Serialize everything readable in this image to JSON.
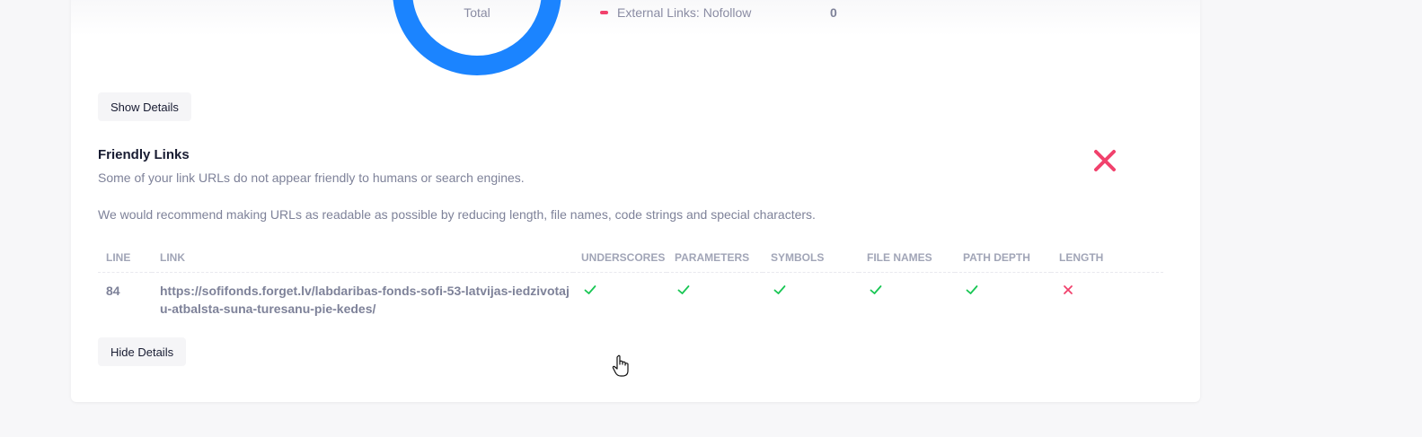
{
  "summary": {
    "donut_center_label": "Total",
    "donut_color": "#1b84ff",
    "legend": {
      "label": "External Links: Nofollow",
      "value": "0",
      "color": "#f1416c"
    }
  },
  "buttons": {
    "show_details": "Show Details",
    "hide_details": "Hide Details"
  },
  "friendly_links": {
    "title": "Friendly Links",
    "status": "fail",
    "status_color": "#f1416c",
    "description": "Some of your link URLs do not appear friendly to humans or search engines.",
    "recommendation": "We would recommend making URLs as readable as possible by reducing length, file names, code strings and special characters.",
    "table": {
      "headers": [
        "LINE",
        "LINK",
        "UNDERSCORES",
        "PARAMETERS",
        "SYMBOLS",
        "FILE NAMES",
        "PATH DEPTH",
        "LENGTH"
      ],
      "rows": [
        {
          "line": "84",
          "link": "https://sofifonds.forget.lv/labdaribas-fonds-sofi-53-latvijas-iedzivotaju-atbalsta-suna-turesanu-pie-kedes/",
          "checks": {
            "underscores": "pass",
            "parameters": "pass",
            "symbols": "pass",
            "file_names": "pass",
            "path_depth": "pass",
            "length": "fail"
          }
        }
      ]
    }
  },
  "colors": {
    "pass": "#17c653",
    "fail": "#f1416c"
  }
}
